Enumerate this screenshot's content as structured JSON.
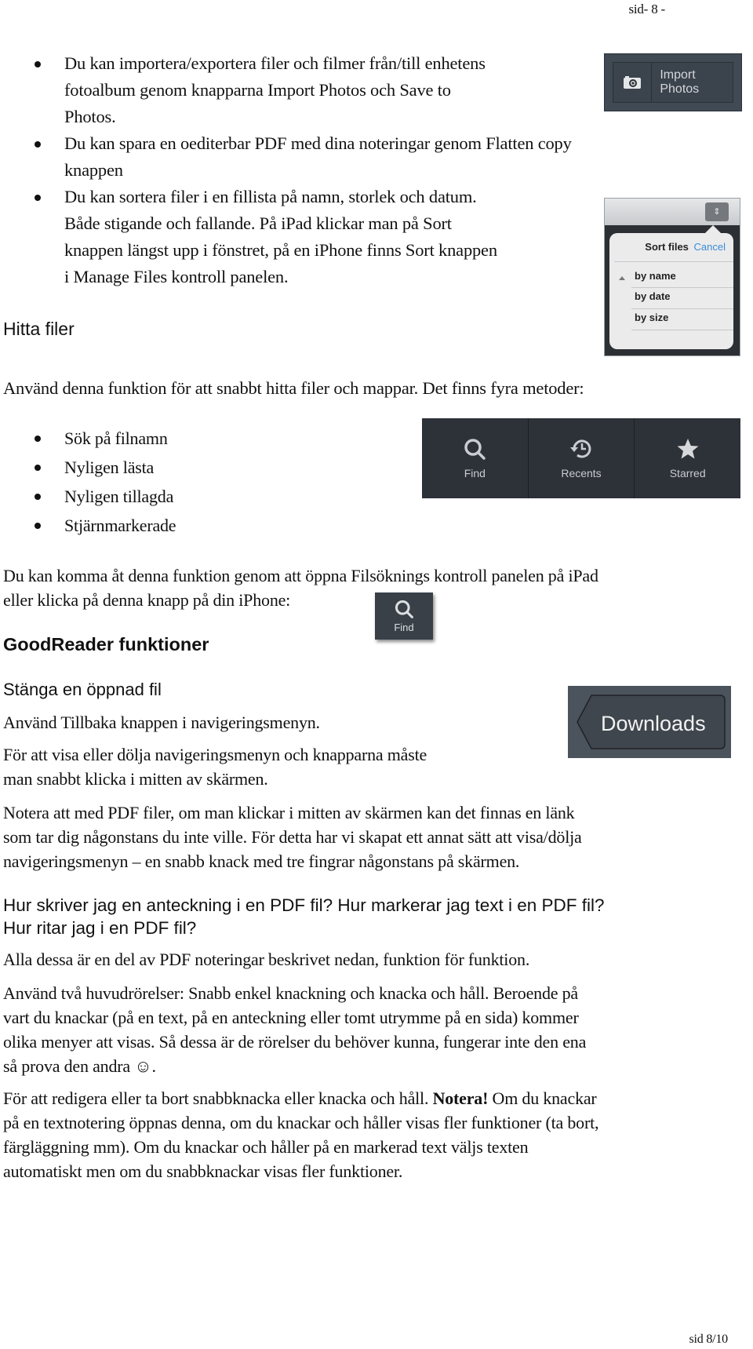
{
  "header": {
    "page_label": "sid- 8 -"
  },
  "footer": {
    "page_label": "sid 8/10"
  },
  "top_list": {
    "items": [
      {
        "lines": [
          "Du kan importera/exportera filer och filmer från/till enhetens",
          "fotoalbum genom knapparna Import Photos och Save to",
          "Photos."
        ]
      },
      {
        "lines": [
          "Du kan spara en oediterbar PDF med dina noteringar genom Flatten copy",
          "knappen"
        ]
      },
      {
        "lines": [
          "Du kan sortera filer i en fillista på namn, storlek och datum.",
          "Både stigande och fallande. På iPad klickar man på Sort",
          "knappen längst upp i fönstret, på en iPhone finns Sort knappen",
          "i Manage Files kontroll panelen."
        ]
      }
    ]
  },
  "import_photos_button": {
    "label": "Import Photos",
    "icon": "camera-icon"
  },
  "sort_popup": {
    "title": "Sort files",
    "cancel_label": "Cancel",
    "options": [
      "by name",
      "by date",
      "by size"
    ],
    "selected": "by name",
    "sort_direction": "ascending",
    "sort_button_icon": "up-down-arrows-icon",
    "accent_color": "#3a8bd8"
  },
  "hitta_filer": {
    "heading": "Hitta filer",
    "intro": "Använd denna funktion för att snabbt hitta filer och mappar. Det finns fyra metoder:",
    "methods": [
      "Sök på filnamn",
      "Nyligen lästa",
      "Nyligen tillagda",
      "Stjärnmarkerade"
    ]
  },
  "search_toolbar": {
    "buttons": [
      {
        "label": "Find",
        "icon": "magnifier-icon"
      },
      {
        "label": "Recents",
        "icon": "history-clock-icon"
      },
      {
        "label": "Starred",
        "icon": "star-icon"
      }
    ]
  },
  "access_paragraph": {
    "lines": [
      "Du kan komma åt denna funktion genom att öppna Filsöknings kontroll panelen på iPad",
      "eller klicka på denna knapp på din iPhone:"
    ]
  },
  "find_small_button": {
    "label": "Find",
    "icon": "magnifier-icon"
  },
  "goodreader_heading": "GoodReader funktioner",
  "stanga": {
    "heading": "Stänga en öppnad fil",
    "p1": "Använd Tillbaka knappen i navigeringsmenyn.",
    "p2_lines": [
      "För att visa eller dölja navigeringsmenyn och knapparna måste",
      "man snabbt klicka i mitten av skärmen."
    ],
    "downloads_button_label": "Downloads"
  },
  "notera_paragraph": {
    "lines": [
      "Notera att med PDF filer, om man klickar i mitten av skärmen kan det finnas en länk",
      "som tar dig någonstans du inte ville. För detta har vi skapat ett annat sätt att visa/dölja",
      "navigeringsmenyn – en snabb knack med tre fingrar någonstans på skärmen."
    ]
  },
  "hur_heading": {
    "lines": [
      "Hur skriver jag en anteckning i en PDF fil? Hur markerar jag text i en PDF fil?",
      "Hur ritar jag i en PDF fil?"
    ]
  },
  "alla_paragraph": "Alla dessa är en del av PDF noteringar beskrivet nedan, funktion för funktion.",
  "anvand_paragraph": {
    "lines": [
      "Använd två huvudrörelser: Snabb enkel knackning och knacka och håll. Beroende på",
      "vart du knackar (på en text, på en anteckning eller tomt utrymme på en sida) kommer",
      "olika menyer att visas. Så dessa är de rörelser du behöver kunna, fungerar inte den ena",
      "så prova den andra ☺."
    ]
  },
  "redigera_paragraph": {
    "line1_before": "För att redigera eller ta bort snabbknacka eller knacka och håll. ",
    "line1_bold": "Notera!",
    "line1_after": " Om du knackar",
    "lines": [
      "på en textnotering öppnas denna, om du knackar och håller visas fler funktioner (ta bort,",
      "färgläggning mm). Om du knackar och håller på en markerad text väljs texten",
      "automatiskt men om du snabbknackar visas fler funktioner."
    ]
  }
}
